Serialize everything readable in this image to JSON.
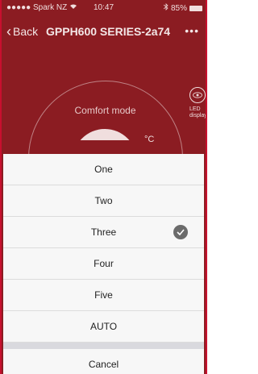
{
  "status_bar": {
    "carrier": "●●●●● Spark NZ",
    "time": "10:47",
    "battery": "85%"
  },
  "nav": {
    "back_label": "Back",
    "title": "GPPH600 SERIES-2a74",
    "more": "•••"
  },
  "background": {
    "mode_label": "Comfort mode",
    "degree_unit": "°C",
    "led_label": "LED display"
  },
  "sheet": {
    "options": [
      {
        "label": "One",
        "selected": false
      },
      {
        "label": "Two",
        "selected": false
      },
      {
        "label": "Three",
        "selected": true
      },
      {
        "label": "Four",
        "selected": false
      },
      {
        "label": "Five",
        "selected": false
      },
      {
        "label": "AUTO",
        "selected": false
      }
    ],
    "cancel_label": "Cancel"
  },
  "colors": {
    "accent_red": "#8b1c22",
    "frame_border": "#c8102e",
    "check": "#6b6b6b"
  }
}
